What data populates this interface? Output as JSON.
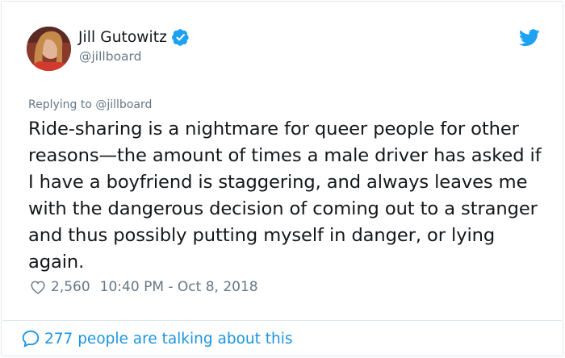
{
  "user": {
    "name": "Jill Gutowitz",
    "handle": "@jillboard"
  },
  "tweet": {
    "replying_to": "Replying to @jillboard",
    "text": "Ride-sharing is a nightmare for queer people for other reasons—the amount of times a male driver has asked if I have a boyfriend is staggering, and always leaves me with the dangerous decision of coming out to a stranger and thus possibly putting myself in danger, or lying again.",
    "likes": "2,560",
    "timestamp": "10:40 PM - Oct 8, 2018"
  },
  "footer": {
    "talking": "277 people are talking about this"
  },
  "colors": {
    "accent": "#1da1f2",
    "link": "#1b95e0",
    "muted": "#657786",
    "text": "#14171a",
    "border": "#e1e8ed"
  },
  "icons": {
    "verified": "verified-badge-icon",
    "logo": "twitter-bird-icon",
    "like": "heart-icon",
    "conversation": "speech-bubble-icon"
  }
}
